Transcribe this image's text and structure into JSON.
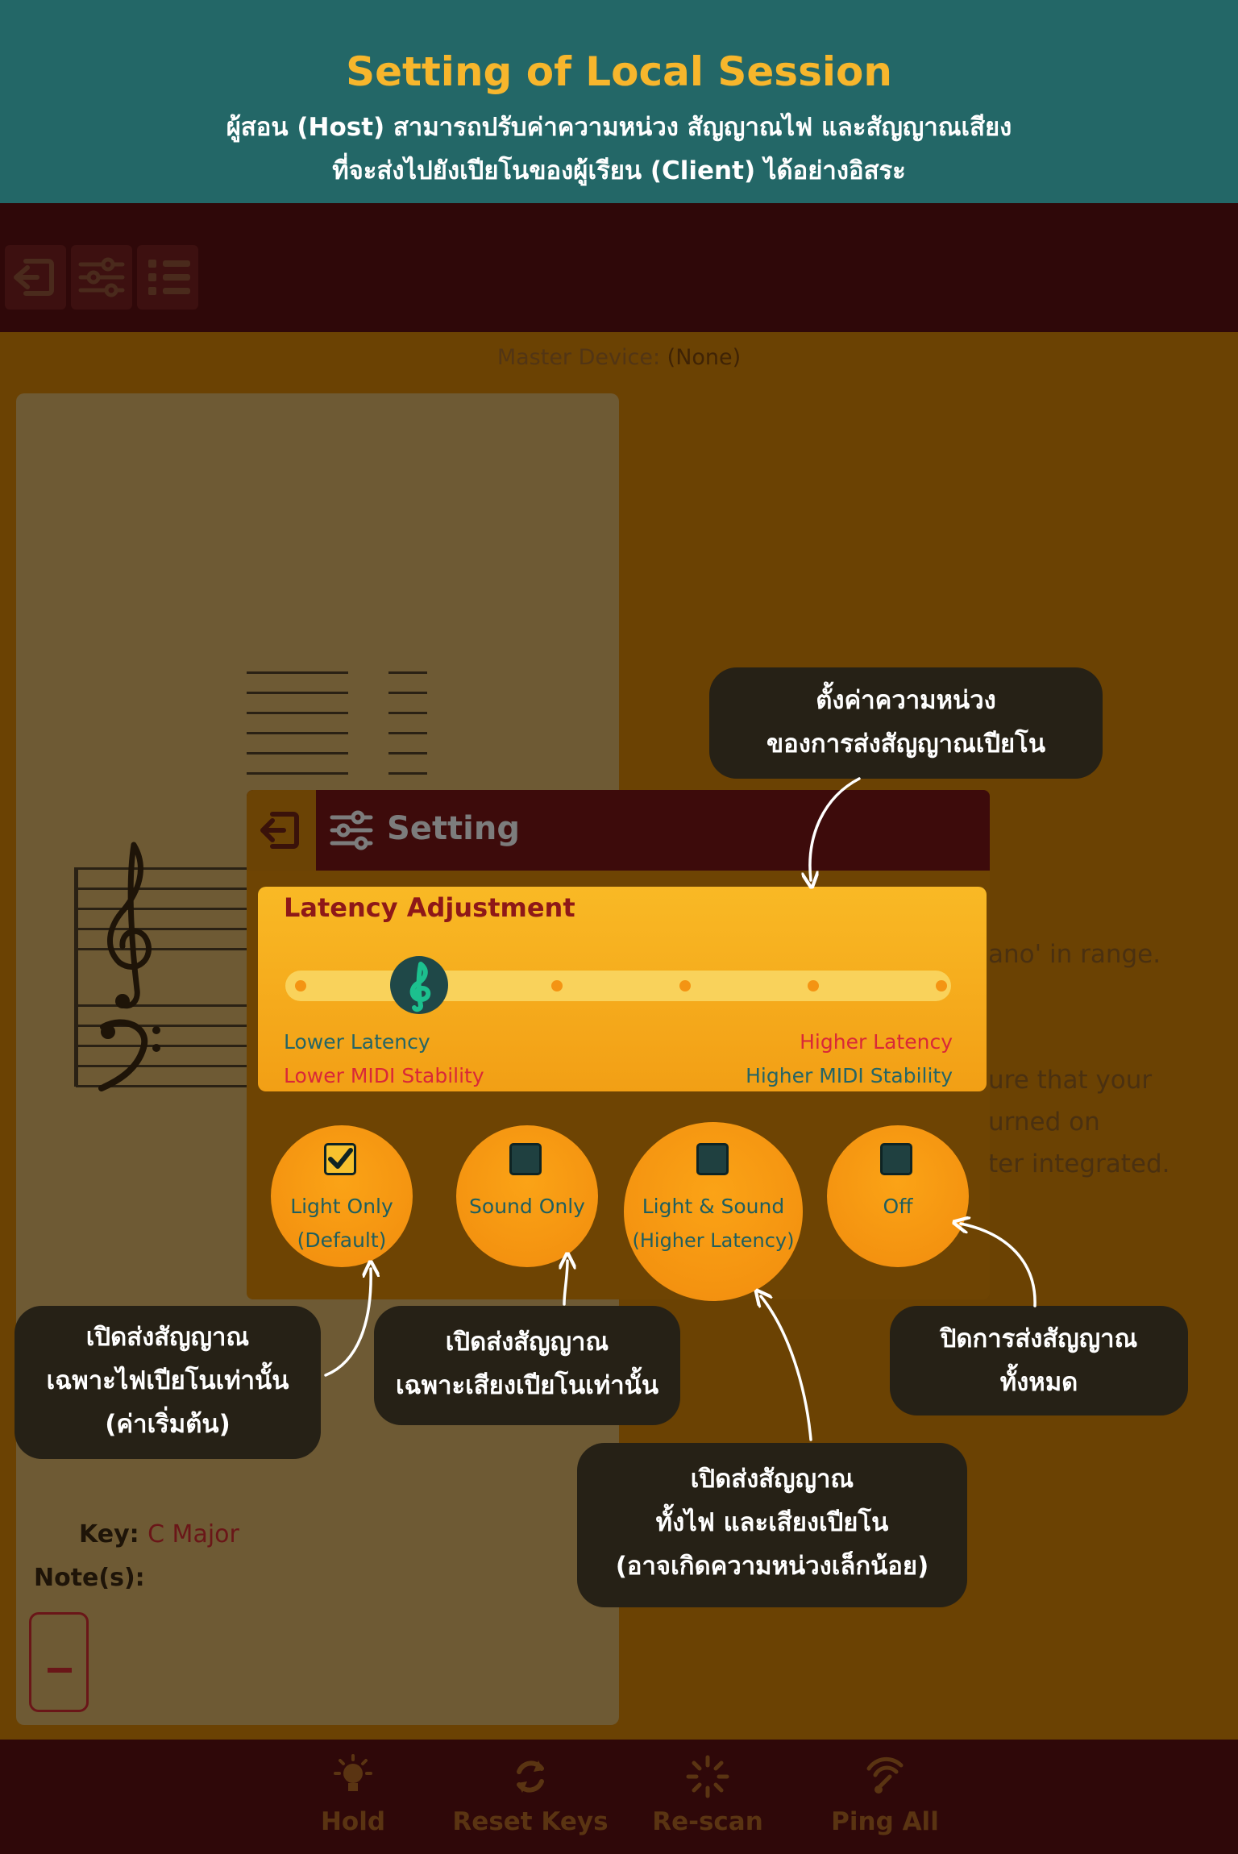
{
  "banner": {
    "title": "Setting of Local Session",
    "line1": "ผู้สอน (Host) สามารถปรับค่าความหน่วง สัญญาณไฟ และสัญญาณเสียง",
    "line2": "ที่จะส่งไปยังเปียโนของผู้เรียน (Client) ได้อย่างอิสระ"
  },
  "topbar": {
    "icons": [
      "exit-icon",
      "sliders-icon",
      "list-icon"
    ]
  },
  "master_device": {
    "label": "Master Device:",
    "value": "(None)"
  },
  "music": {
    "key_label": "Key:",
    "key_value": "C Major",
    "notes_label": "Note(s):"
  },
  "help_text": {
    "line1": "ano' in range.",
    "line2": "ure that your",
    "line3": "urned on",
    "line4": "ter integrated."
  },
  "dialog": {
    "title": "Setting",
    "latency": {
      "title": "Latency Adjustment",
      "steps": 6,
      "selected_step": 2,
      "left_top": "Lower Latency",
      "left_bottom": "Lower MIDI Stability",
      "right_top": "Higher Latency",
      "right_bottom": "Higher MIDI Stability"
    },
    "options": [
      {
        "line1": "Light Only",
        "line2": "(Default)",
        "checked": true
      },
      {
        "line1": "Sound Only",
        "line2": "",
        "checked": false
      },
      {
        "line1": "Light & Sound",
        "line2": "(Higher Latency)",
        "checked": false
      },
      {
        "line1": "Off",
        "line2": "",
        "checked": false
      }
    ]
  },
  "callouts": {
    "latency": {
      "line1": "ตั้งค่าความหน่วง",
      "line2": "ของการส่งสัญญาณเปียโน"
    },
    "light_only": {
      "line1": "เปิดส่งสัญญาณ",
      "line2": "เฉพาะไฟเปียโนเท่านั้น",
      "line3": "(ค่าเริ่มต้น)"
    },
    "sound_only": {
      "line1": "เปิดส่งสัญญาณ",
      "line2": "เฉพาะเสียงเปียโนเท่านั้น"
    },
    "light_sound": {
      "line1": "เปิดส่งสัญญาณ",
      "line2": "ทั้งไฟ และเสียงเปียโน",
      "line3": "(อาจเกิดความหน่วงเล็กน้อย)"
    },
    "off": {
      "line1": "ปิดการส่งสัญญาณ",
      "line2": "ทั้งหมด"
    }
  },
  "bottombar": {
    "buttons": [
      {
        "label": "Hold",
        "icon": "bulb-icon"
      },
      {
        "label": "Reset Keys",
        "icon": "refresh-icon"
      },
      {
        "label": "Re-scan",
        "icon": "spinner-icon"
      },
      {
        "label": "Ping All",
        "icon": "signal-icon"
      }
    ]
  },
  "colors": {
    "banner_bg": "#236767",
    "banner_title": "#f7b62c",
    "dark_bar": "#2f0809",
    "accent_orange": "#f49310",
    "teal_text": "#256566",
    "red_text": "#d92838"
  }
}
